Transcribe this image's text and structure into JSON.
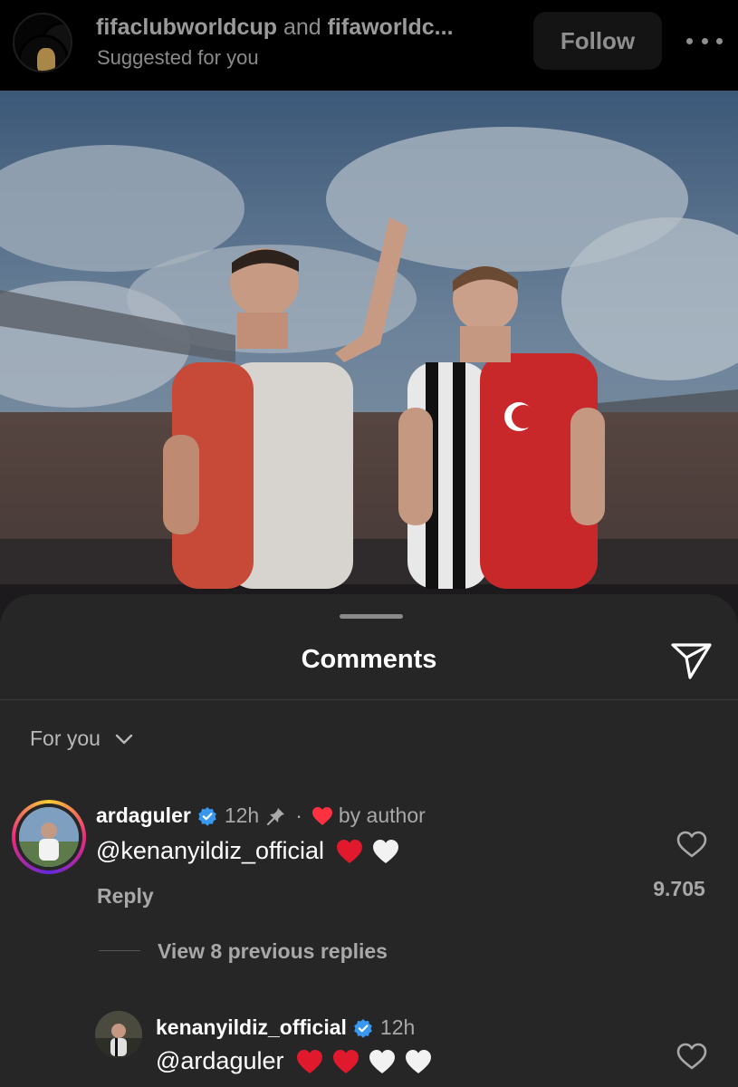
{
  "header": {
    "account_1": "fifaclubworldcup",
    "joiner": " and ",
    "account_2": "fifaworldc...",
    "subtitle": "Suggested for you",
    "follow_label": "Follow"
  },
  "sheet": {
    "title": "Comments",
    "filter_label": "For you"
  },
  "comment": {
    "username": "ardaguler",
    "time": "12h",
    "dot": "·",
    "liked_by": "by author",
    "text": "@kenanyildiz_official",
    "reply_label": "Reply",
    "like_count": "9.705",
    "view_replies": "View 8 previous replies"
  },
  "reply": {
    "username": "kenanyildiz_official",
    "time": "12h",
    "text": "@ardaguler"
  },
  "colors": {
    "background": "#000000",
    "sheet": "#262626",
    "verified": "#3897f0",
    "heart_red": "#ff3040"
  },
  "icons": [
    "more-icon",
    "send-icon",
    "chevron-down-icon",
    "verified-icon",
    "pin-icon",
    "heart-icon"
  ]
}
